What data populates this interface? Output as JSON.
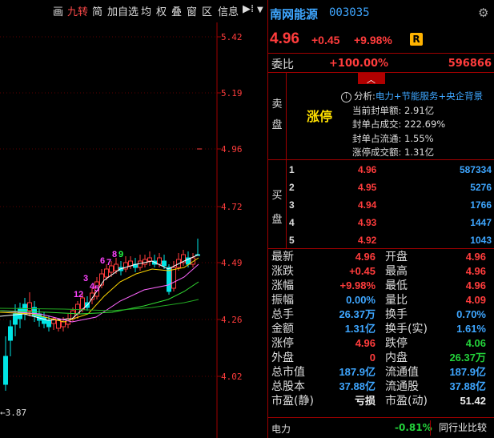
{
  "toolbar": {
    "items": [
      "画",
      "九转",
      "简",
      "加自选",
      "均",
      "权",
      "叠",
      "窗",
      "区",
      "信息"
    ],
    "menu_icon": "play-menu-icon"
  },
  "chart": {
    "price_labels": [
      "5.42",
      "5.19",
      "4.96",
      "4.72",
      "4.49",
      "4.26",
      "4.02"
    ],
    "low_label": "3.87",
    "nine_turn_numbers": [
      "1",
      "2",
      "3",
      "4",
      "5",
      "6",
      "7",
      "8",
      "9"
    ],
    "colors": {
      "up": "#ff3c3c",
      "down": "#00e5e5",
      "ma_white": "#ffffff",
      "ma_yellow": "#ffd700",
      "ma_pink": "#ff66ff",
      "ma_green": "#33dd33"
    }
  },
  "header": {
    "name": "南网能源",
    "code": "003035",
    "price": "4.96",
    "change": "+0.45",
    "change_pct": "+9.98%",
    "badge": "R"
  },
  "weibi": {
    "label": "委比",
    "pct": "+100.00%",
    "value": "596866"
  },
  "sell": {
    "label_1": "卖",
    "label_2": "盘",
    "limit_up": "涨停",
    "analysis_title": "分析:",
    "analysis_tags": "电力+节能服务+央企背景",
    "lines": [
      {
        "k": "当前封单额:",
        "v": "2.91亿"
      },
      {
        "k": "封单占成交:",
        "v": "222.69%"
      },
      {
        "k": "封单占流通:",
        "v": "1.55%"
      },
      {
        "k": "涨停成交额:",
        "v": "1.31亿"
      }
    ]
  },
  "buy": {
    "label_1": "买",
    "label_2": "盘",
    "rows": [
      {
        "lvl": "1",
        "px": "4.96",
        "vol": "587334"
      },
      {
        "lvl": "2",
        "px": "4.95",
        "vol": "5276"
      },
      {
        "lvl": "3",
        "px": "4.94",
        "vol": "1766"
      },
      {
        "lvl": "4",
        "px": "4.93",
        "vol": "1447"
      },
      {
        "lvl": "5",
        "px": "4.92",
        "vol": "1043"
      }
    ]
  },
  "stats": {
    "left": [
      {
        "k": "最新",
        "v": "4.96",
        "c": "red"
      },
      {
        "k": "涨跌",
        "v": "+0.45",
        "c": "red"
      },
      {
        "k": "涨幅",
        "v": "+9.98%",
        "c": "red"
      },
      {
        "k": "振幅",
        "v": "0.00%",
        "c": "cyan"
      },
      {
        "k": "总手",
        "v": "26.37万",
        "c": "cyan"
      },
      {
        "k": "金额",
        "v": "1.31亿",
        "c": "cyan"
      },
      {
        "k": "涨停",
        "v": "4.96",
        "c": "red"
      },
      {
        "k": "外盘",
        "v": "0",
        "c": "red"
      },
      {
        "k": "总市值",
        "v": "187.9亿",
        "c": "cyan"
      },
      {
        "k": "总股本",
        "v": "37.88亿",
        "c": "cyan"
      },
      {
        "k": "市盈(静)",
        "v": "亏损",
        "c": "white"
      }
    ],
    "right": [
      {
        "k": "开盘",
        "v": "4.96",
        "c": "red"
      },
      {
        "k": "最高",
        "v": "4.96",
        "c": "red"
      },
      {
        "k": "最低",
        "v": "4.96",
        "c": "red"
      },
      {
        "k": "量比",
        "v": "4.09",
        "c": "red"
      },
      {
        "k": "换手",
        "v": "0.70%",
        "c": "cyan"
      },
      {
        "k": "换手(实)",
        "v": "1.61%",
        "c": "cyan"
      },
      {
        "k": "跌停",
        "v": "4.06",
        "c": "green"
      },
      {
        "k": "内盘",
        "v": "26.37万",
        "c": "green"
      },
      {
        "k": "流通值",
        "v": "187.9亿",
        "c": "cyan"
      },
      {
        "k": "流通股",
        "v": "37.88亿",
        "c": "cyan"
      },
      {
        "k": "市盈(动)",
        "v": "51.42",
        "c": "white"
      }
    ]
  },
  "footer": {
    "sector": "电力",
    "sector_pct": "-0.81%",
    "button": "同行业比较"
  }
}
